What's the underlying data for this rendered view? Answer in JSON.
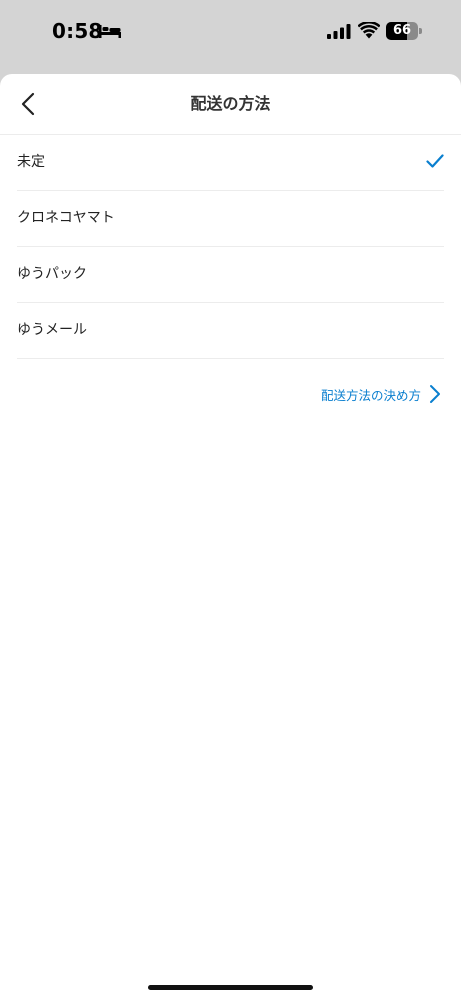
{
  "status_bar": {
    "time": "0:58",
    "battery_level": "66",
    "battery_fraction": 0.66,
    "icons": [
      "bed-icon",
      "signal-icon",
      "wifi-icon",
      "battery-icon"
    ]
  },
  "header": {
    "title": "配送の方法",
    "back_icon": "chevron-left-icon"
  },
  "options": [
    {
      "label": "未定",
      "selected": true
    },
    {
      "label": "クロネコヤマト",
      "selected": false
    },
    {
      "label": "ゆうパック",
      "selected": false
    },
    {
      "label": "ゆうメール",
      "selected": false
    }
  ],
  "help_link": {
    "label": "配送方法の決め方",
    "icon": "chevron-right-icon"
  },
  "colors": {
    "accent": "#0a7fcf",
    "status_bar_bg": "#d4d4d4",
    "divider": "#ececec",
    "text": "#222222"
  }
}
